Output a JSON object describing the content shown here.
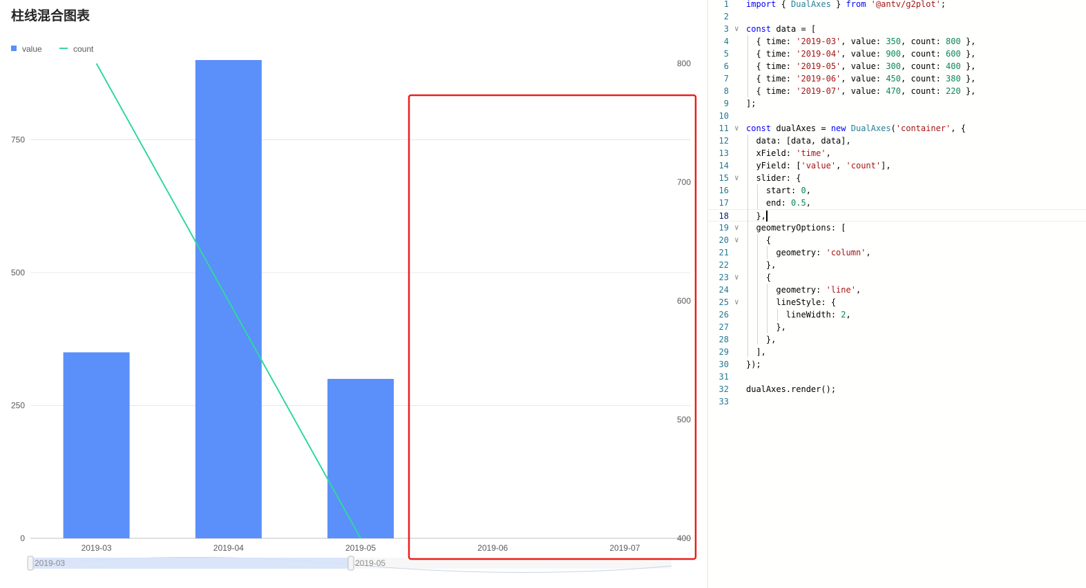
{
  "chart": {
    "title": "柱线混合图表",
    "legend": [
      {
        "name": "value",
        "color": "#5B8FF9",
        "marker": "square"
      },
      {
        "name": "count",
        "color": "#30D7A0",
        "marker": "line"
      }
    ],
    "slider": {
      "start_label": "2019-03",
      "end_label": "2019-05",
      "start": 0,
      "end": 0.5
    },
    "highlight_box_color": "#ee1c1c"
  },
  "chart_data": {
    "type": "bar",
    "categories": [
      "2019-03",
      "2019-04",
      "2019-05",
      "2019-06",
      "2019-07"
    ],
    "series": [
      {
        "name": "value",
        "type": "bar",
        "axis": "left",
        "values": [
          350,
          900,
          300,
          null,
          null
        ],
        "color": "#5B8FF9"
      },
      {
        "name": "count",
        "type": "line",
        "axis": "right",
        "values": [
          800,
          600,
          400,
          null,
          null
        ],
        "color": "#30D7A0"
      }
    ],
    "left_axis": {
      "ticks": [
        0,
        250,
        500,
        750
      ],
      "range": [
        0,
        900
      ]
    },
    "right_axis": {
      "ticks": [
        400,
        500,
        600,
        700,
        800
      ],
      "range": [
        400,
        800
      ]
    },
    "legend_position": "top-left",
    "grid": true
  },
  "editor": {
    "current_line": 18,
    "lines": [
      {
        "n": 1,
        "fold": false,
        "tokens": [
          [
            "kw",
            "import"
          ],
          [
            "plain",
            " { "
          ],
          [
            "type",
            "DualAxes"
          ],
          [
            "plain",
            " } "
          ],
          [
            "kw",
            "from"
          ],
          [
            "plain",
            " "
          ],
          [
            "str",
            "'@antv/g2plot'"
          ],
          [
            "plain",
            ";"
          ]
        ]
      },
      {
        "n": 2,
        "fold": false,
        "tokens": []
      },
      {
        "n": 3,
        "fold": true,
        "tokens": [
          [
            "kw",
            "const"
          ],
          [
            "plain",
            " data = ["
          ]
        ]
      },
      {
        "n": 4,
        "fold": false,
        "tokens": [
          [
            "plain",
            "  { time: "
          ],
          [
            "str",
            "'2019-03'"
          ],
          [
            "plain",
            ", value: "
          ],
          [
            "num",
            "350"
          ],
          [
            "plain",
            ", count: "
          ],
          [
            "num",
            "800"
          ],
          [
            "plain",
            " },"
          ]
        ]
      },
      {
        "n": 5,
        "fold": false,
        "tokens": [
          [
            "plain",
            "  { time: "
          ],
          [
            "str",
            "'2019-04'"
          ],
          [
            "plain",
            ", value: "
          ],
          [
            "num",
            "900"
          ],
          [
            "plain",
            ", count: "
          ],
          [
            "num",
            "600"
          ],
          [
            "plain",
            " },"
          ]
        ]
      },
      {
        "n": 6,
        "fold": false,
        "tokens": [
          [
            "plain",
            "  { time: "
          ],
          [
            "str",
            "'2019-05'"
          ],
          [
            "plain",
            ", value: "
          ],
          [
            "num",
            "300"
          ],
          [
            "plain",
            ", count: "
          ],
          [
            "num",
            "400"
          ],
          [
            "plain",
            " },"
          ]
        ]
      },
      {
        "n": 7,
        "fold": false,
        "tokens": [
          [
            "plain",
            "  { time: "
          ],
          [
            "str",
            "'2019-06'"
          ],
          [
            "plain",
            ", value: "
          ],
          [
            "num",
            "450"
          ],
          [
            "plain",
            ", count: "
          ],
          [
            "num",
            "380"
          ],
          [
            "plain",
            " },"
          ]
        ]
      },
      {
        "n": 8,
        "fold": false,
        "tokens": [
          [
            "plain",
            "  { time: "
          ],
          [
            "str",
            "'2019-07'"
          ],
          [
            "plain",
            ", value: "
          ],
          [
            "num",
            "470"
          ],
          [
            "plain",
            ", count: "
          ],
          [
            "num",
            "220"
          ],
          [
            "plain",
            " },"
          ]
        ]
      },
      {
        "n": 9,
        "fold": false,
        "tokens": [
          [
            "plain",
            "];"
          ]
        ]
      },
      {
        "n": 10,
        "fold": false,
        "tokens": []
      },
      {
        "n": 11,
        "fold": true,
        "tokens": [
          [
            "kw",
            "const"
          ],
          [
            "plain",
            " dualAxes = "
          ],
          [
            "kw",
            "new"
          ],
          [
            "plain",
            " "
          ],
          [
            "type",
            "DualAxes"
          ],
          [
            "plain",
            "("
          ],
          [
            "str",
            "'container'"
          ],
          [
            "plain",
            ", {"
          ]
        ]
      },
      {
        "n": 12,
        "fold": false,
        "tokens": [
          [
            "plain",
            "  data: [data, data],"
          ]
        ]
      },
      {
        "n": 13,
        "fold": false,
        "tokens": [
          [
            "plain",
            "  xField: "
          ],
          [
            "str",
            "'time'"
          ],
          [
            "plain",
            ","
          ]
        ]
      },
      {
        "n": 14,
        "fold": false,
        "tokens": [
          [
            "plain",
            "  yField: ["
          ],
          [
            "str",
            "'value'"
          ],
          [
            "plain",
            ", "
          ],
          [
            "str",
            "'count'"
          ],
          [
            "plain",
            "],"
          ]
        ]
      },
      {
        "n": 15,
        "fold": true,
        "tokens": [
          [
            "plain",
            "  slider: {"
          ]
        ]
      },
      {
        "n": 16,
        "fold": false,
        "tokens": [
          [
            "plain",
            "    start: "
          ],
          [
            "num",
            "0"
          ],
          [
            "plain",
            ","
          ]
        ]
      },
      {
        "n": 17,
        "fold": false,
        "tokens": [
          [
            "plain",
            "    end: "
          ],
          [
            "num",
            "0.5"
          ],
          [
            "plain",
            ","
          ]
        ]
      },
      {
        "n": 18,
        "fold": false,
        "tokens": [
          [
            "plain",
            "  },"
          ]
        ]
      },
      {
        "n": 19,
        "fold": true,
        "tokens": [
          [
            "plain",
            "  geometryOptions: ["
          ]
        ]
      },
      {
        "n": 20,
        "fold": true,
        "tokens": [
          [
            "plain",
            "    {"
          ]
        ]
      },
      {
        "n": 21,
        "fold": false,
        "tokens": [
          [
            "plain",
            "      geometry: "
          ],
          [
            "str",
            "'column'"
          ],
          [
            "plain",
            ","
          ]
        ]
      },
      {
        "n": 22,
        "fold": false,
        "tokens": [
          [
            "plain",
            "    },"
          ]
        ]
      },
      {
        "n": 23,
        "fold": true,
        "tokens": [
          [
            "plain",
            "    {"
          ]
        ]
      },
      {
        "n": 24,
        "fold": false,
        "tokens": [
          [
            "plain",
            "      geometry: "
          ],
          [
            "str",
            "'line'"
          ],
          [
            "plain",
            ","
          ]
        ]
      },
      {
        "n": 25,
        "fold": true,
        "tokens": [
          [
            "plain",
            "      lineStyle: {"
          ]
        ]
      },
      {
        "n": 26,
        "fold": false,
        "tokens": [
          [
            "plain",
            "        lineWidth: "
          ],
          [
            "num",
            "2"
          ],
          [
            "plain",
            ","
          ]
        ]
      },
      {
        "n": 27,
        "fold": false,
        "tokens": [
          [
            "plain",
            "      },"
          ]
        ]
      },
      {
        "n": 28,
        "fold": false,
        "tokens": [
          [
            "plain",
            "    },"
          ]
        ]
      },
      {
        "n": 29,
        "fold": false,
        "tokens": [
          [
            "plain",
            "  ],"
          ]
        ]
      },
      {
        "n": 30,
        "fold": false,
        "tokens": [
          [
            "plain",
            "});"
          ]
        ]
      },
      {
        "n": 31,
        "fold": false,
        "tokens": []
      },
      {
        "n": 32,
        "fold": false,
        "tokens": [
          [
            "plain",
            "dualAxes.render();"
          ]
        ]
      },
      {
        "n": 33,
        "fold": false,
        "tokens": []
      }
    ]
  }
}
